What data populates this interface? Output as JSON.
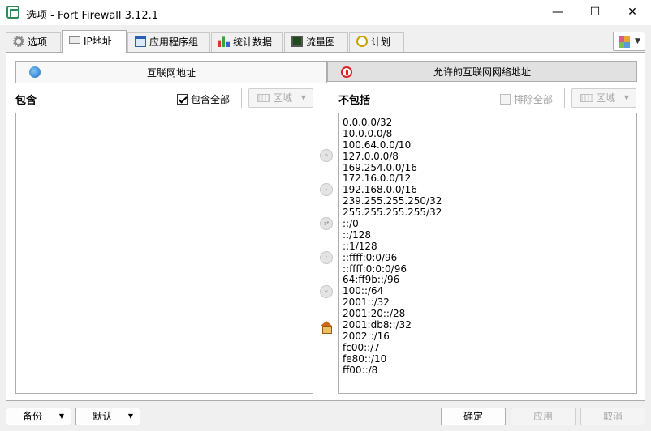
{
  "window": {
    "title": "选项 - Fort Firewall 3.12.1",
    "controls": {
      "minimize": "—",
      "maximize": "☐",
      "close": "✕"
    }
  },
  "tabs": [
    {
      "label": "选项",
      "icon": "gear-icon",
      "active": false
    },
    {
      "label": "IP地址",
      "icon": "ip-icon",
      "active": true
    },
    {
      "label": "应用程序组",
      "icon": "window-icon",
      "active": false
    },
    {
      "label": "统计数据",
      "icon": "bar-chart-icon",
      "active": false
    },
    {
      "label": "流量图",
      "icon": "monitor-icon",
      "active": false
    },
    {
      "label": "计划",
      "icon": "clock-icon",
      "active": false
    }
  ],
  "subtabs": {
    "internet": "互联网地址",
    "allowed": "允许的互联网网络地址"
  },
  "include": {
    "label": "包含",
    "include_all_label": "包含全部",
    "include_all_checked": true,
    "zones_label": "区域",
    "addresses": []
  },
  "exclude": {
    "label": "不包括",
    "exclude_all_label": "排除全部",
    "exclude_all_checked": false,
    "zones_label": "区域",
    "addresses": [
      "0.0.0.0/32",
      "10.0.0.0/8",
      "100.64.0.0/10",
      "127.0.0.0/8",
      "169.254.0.0/16",
      "172.16.0.0/12",
      "192.168.0.0/16",
      "239.255.255.250/32",
      "255.255.255.255/32",
      "::/0",
      "::/128",
      "::1/128",
      "::ffff:0:0/96",
      "::ffff:0:0:0/96",
      "64:ff9b::/96",
      "100::/64",
      "2001::/32",
      "2001:20::/28",
      "2001:db8::/32",
      "2002::/16",
      "fc00::/7",
      "fe80::/10",
      "ff00::/8"
    ]
  },
  "middle_controls": {
    "move_all_right": "»",
    "move_right": "›",
    "swap": "⇄",
    "move_left": "‹",
    "move_all_left": "«"
  },
  "footer": {
    "backup": "备份",
    "defaults": "默认",
    "ok": "确定",
    "apply": "应用",
    "cancel": "取消"
  }
}
